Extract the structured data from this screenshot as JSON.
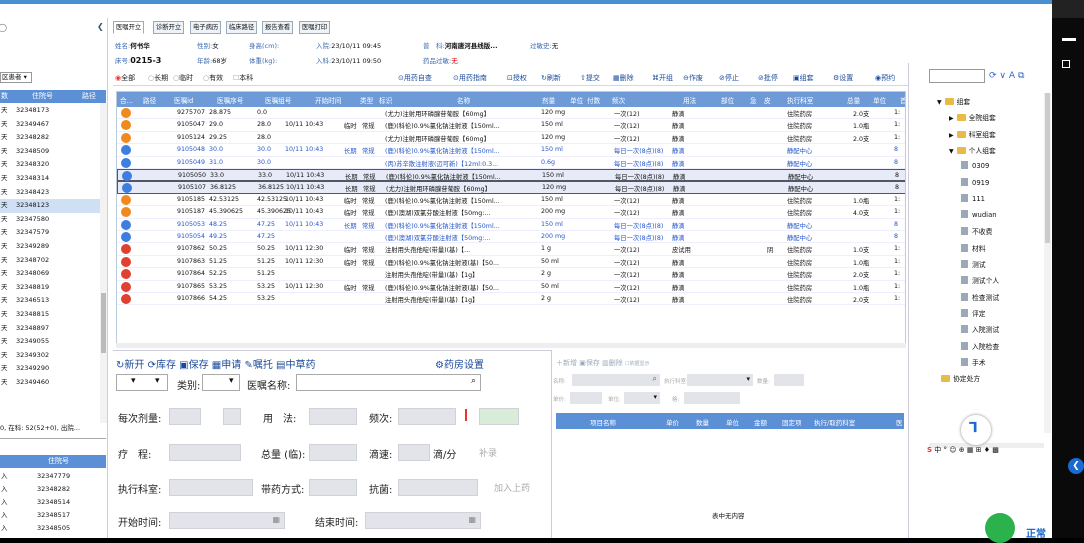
{
  "tabs": [
    "医嘱开立",
    "诊断开立",
    "电子病历",
    "临床路径",
    "报告查看",
    "医嘱打印"
  ],
  "patient": {
    "name_label": "姓名:",
    "name": "何书华",
    "sex_label": "性别:",
    "sex": "女",
    "height_label": "身高(cm):",
    "admit_label": "入院:",
    "admit": "23/10/11 09:45",
    "ward_label": "床号:",
    "ward": "0215-3",
    "age_label": "年龄:",
    "age": "68岁",
    "weight_label": "体重(kg):",
    "enter_label": "入科:",
    "enter": "23/10/11 09:50",
    "dept_label_a": "普",
    "dept_label_b": "科:",
    "dept": "河南唐河县线版...",
    "allergy_label": "过敏史:",
    "allergy": "无",
    "drug_allergy_label": "药品过敏:",
    "drug_allergy": "无"
  },
  "toolbar": {
    "filters": [
      "全部",
      "长期",
      "临时",
      "有效",
      "本科"
    ],
    "actions": [
      "用药自查",
      "用药指南",
      "授权",
      "刷新",
      "提交",
      "删除",
      "开组",
      "作废",
      "停止",
      "批停",
      "组套",
      "设置",
      "预约"
    ]
  },
  "grid": {
    "columns": [
      "合...",
      "路径",
      "医嘱id",
      "医嘱序号",
      "医嘱组号",
      "开始时间",
      "类型",
      "标识",
      "名称",
      "剂量",
      "单位",
      "付数",
      "频次",
      "用法",
      "部位",
      "急",
      "皮",
      "执行科室",
      "总量",
      "单位",
      "首"
    ],
    "rows": [
      {
        "id": "9275707",
        "seq": "28.875",
        "grp": "0.0",
        "start": "",
        "type": "",
        "flag": "",
        "name": "(尤力)注射用环磷腺苷葡胺【60mg】",
        "dose": "120 mg",
        "freq": "一次(12)",
        "usage": "静滴",
        "dept": "住院药房",
        "total": "2.0支",
        "u": "1:",
        "color": "#f08a1e",
        "cls": ""
      },
      {
        "id": "9105047",
        "seq": "29.0",
        "grp": "28.0",
        "start": "10/11 10:43",
        "type": "临时",
        "flag": "常规",
        "name": "(鹿)(科伦)0.9%氯化钠注射液【150ml...",
        "dose": "150 ml",
        "freq": "一次(12)",
        "usage": "静滴",
        "dept": "住院药房",
        "total": "1.0瓶",
        "u": "1:",
        "color": "#f08a1e",
        "cls": ""
      },
      {
        "id": "9105124",
        "seq": "29.25",
        "grp": "28.0",
        "start": "",
        "type": "",
        "flag": "",
        "name": "(尤力)注射用环磷腺苷葡胺【60mg】",
        "dose": "120 mg",
        "freq": "一次(12)",
        "usage": "静滴",
        "dept": "住院药房",
        "total": "2.0支",
        "u": "1:",
        "color": "#f08a1e",
        "cls": ""
      },
      {
        "id": "9105048",
        "seq": "30.0",
        "grp": "30.0",
        "start": "10/11 10:43",
        "type": "长期",
        "flag": "常规",
        "name": "(鹿)(科伦)0.9%氯化钠注射液【150ml...",
        "dose": "150 ml",
        "freq": "每日一次(8点)(8)",
        "usage": "静滴",
        "dept": "静配中心",
        "total": "",
        "u": "8",
        "color": "#3d7fe0",
        "cls": "blue"
      },
      {
        "id": "9105049",
        "seq": "31.0",
        "grp": "30.0",
        "start": "",
        "type": "",
        "flag": "",
        "name": "(丙)苏辛散注射液(迈可新)【12ml:0.3...",
        "dose": "0.6g",
        "freq": "每日一次(8点)(8)",
        "usage": "静滴",
        "dept": "静配中心",
        "total": "",
        "u": "8",
        "color": "#3d7fe0",
        "cls": "blue"
      },
      {
        "id": "9105050",
        "seq": "33.0",
        "grp": "33.0",
        "start": "10/11 10:43",
        "type": "长期",
        "flag": "常规",
        "name": "(鹿)(科伦)0.9%氯化钠注射液【150ml...",
        "dose": "150 ml",
        "freq": "每日一次(8点)(8)",
        "usage": "静滴",
        "dept": "静配中心",
        "total": "",
        "u": "8",
        "color": "#3d7fe0",
        "cls": "sel"
      },
      {
        "id": "9105107",
        "seq": "36.8125",
        "grp": "36.8125",
        "start": "10/11 10:43",
        "type": "长期",
        "flag": "常规",
        "name": "(尤力)注射用环磷腺苷葡胺【60mg】",
        "dose": "120 mg",
        "freq": "每日一次(8点)(8)",
        "usage": "静滴",
        "dept": "静配中心",
        "total": "",
        "u": "8",
        "color": "#3d7fe0",
        "cls": "sel"
      },
      {
        "id": "9105185",
        "seq": "42.53125",
        "grp": "42.53125",
        "start": "10/11 10:43",
        "type": "临时",
        "flag": "常规",
        "name": "(鹿)(科伦)0.9%氯化钠注射液【150ml...",
        "dose": "150 ml",
        "freq": "一次(12)",
        "usage": "静滴",
        "dept": "住院药房",
        "total": "1.0瓶",
        "u": "1:",
        "color": "#f08a1e",
        "cls": ""
      },
      {
        "id": "9105187",
        "seq": "45.390625",
        "grp": "45.390625",
        "start": "10/11 10:43",
        "type": "临时",
        "flag": "常规",
        "name": "(鹿)(澳湖)双氯芬酸注射液【50mg:...",
        "dose": "200 mg",
        "freq": "一次(12)",
        "usage": "静滴",
        "dept": "住院药房",
        "total": "4.0支",
        "u": "1:",
        "color": "#f08a1e",
        "cls": ""
      },
      {
        "id": "9105053",
        "seq": "48.25",
        "grp": "47.25",
        "start": "10/11 10:43",
        "type": "长期",
        "flag": "常规",
        "name": "(鹿)(科伦)0.9%氯化钠注射液【150ml...",
        "dose": "150 ml",
        "freq": "每日一次(8点)(8)",
        "usage": "静滴",
        "dept": "静配中心",
        "total": "",
        "u": "8",
        "color": "#3d7fe0",
        "cls": "blue"
      },
      {
        "id": "9105054",
        "seq": "49.25",
        "grp": "47.25",
        "start": "",
        "type": "",
        "flag": "",
        "name": "(鹿)(澳湖)双氯芬酸注射液【50mg:...",
        "dose": "200 mg",
        "freq": "每日一次(8点)(8)",
        "usage": "静滴",
        "dept": "静配中心",
        "total": "",
        "u": "8",
        "color": "#3d7fe0",
        "cls": "blue"
      },
      {
        "id": "9107862",
        "seq": "50.25",
        "grp": "50.25",
        "start": "10/11 12:30",
        "type": "临时",
        "flag": "常规",
        "name": "注射用头孢他啶(带量)(基)【...",
        "dose": "1 g",
        "freq": "一次(12)",
        "usage": "皮试用",
        "dept": "住院药房",
        "total": "1.0支",
        "u": "1:",
        "color": "#e04030",
        "cls": "",
        "skin": "阴"
      },
      {
        "id": "9107863",
        "seq": "51.25",
        "grp": "51.25",
        "start": "10/11 12:30",
        "type": "临时",
        "flag": "常规",
        "name": "(鹿)(科伦)0.9%氯化钠注射液(基)【50...",
        "dose": "50 ml",
        "freq": "一次(12)",
        "usage": "静滴",
        "dept": "住院药房",
        "total": "1.0瓶",
        "u": "1:",
        "color": "#e04030",
        "cls": ""
      },
      {
        "id": "9107864",
        "seq": "52.25",
        "grp": "51.25",
        "start": "",
        "type": "",
        "flag": "",
        "name": "注射用头孢他啶(带量)(基)【1g】",
        "dose": "2 g",
        "freq": "一次(12)",
        "usage": "静滴",
        "dept": "住院药房",
        "total": "2.0支",
        "u": "1:",
        "color": "#e04030",
        "cls": ""
      },
      {
        "id": "9107865",
        "seq": "53.25",
        "grp": "53.25",
        "start": "10/11 12:30",
        "type": "临时",
        "flag": "常规",
        "name": "(鹿)(科伦)0.9%氯化钠注射液(基)【50...",
        "dose": "50 ml",
        "freq": "一次(12)",
        "usage": "静滴",
        "dept": "住院药房",
        "total": "1.0瓶",
        "u": "1:",
        "color": "#e04030",
        "cls": ""
      },
      {
        "id": "9107866",
        "seq": "54.25",
        "grp": "53.25",
        "start": "",
        "type": "",
        "flag": "",
        "name": "注射用头孢他啶(带量)(基)【1g】",
        "dose": "2 g",
        "freq": "一次(12)",
        "usage": "静滴",
        "dept": "住院药房",
        "total": "2.0支",
        "u": "1:",
        "color": "#e04030",
        "cls": ""
      }
    ]
  },
  "left": {
    "filter": "区患者",
    "header": [
      "数",
      "住院号",
      "路径"
    ],
    "rows": [
      {
        "a": "天",
        "b": "32348173"
      },
      {
        "a": "天",
        "b": "32349467"
      },
      {
        "a": "天",
        "b": "32348282"
      },
      {
        "a": "天",
        "b": "32348509"
      },
      {
        "a": "天",
        "b": "32348320"
      },
      {
        "a": "天",
        "b": "32348314"
      },
      {
        "a": "天",
        "b": "32348423"
      },
      {
        "a": "天",
        "b": "32348123"
      },
      {
        "a": "天",
        "b": "32347580"
      },
      {
        "a": "天",
        "b": "32347579"
      },
      {
        "a": "天",
        "b": "32349289"
      },
      {
        "a": "天",
        "b": "32348702"
      },
      {
        "a": "天",
        "b": "32348069"
      },
      {
        "a": "天",
        "b": "32348819"
      },
      {
        "a": "天",
        "b": "32346513"
      },
      {
        "a": "天",
        "b": "32348815"
      },
      {
        "a": "天",
        "b": "32348897"
      },
      {
        "a": "天",
        "b": "32349055"
      },
      {
        "a": "天",
        "b": "32349302"
      },
      {
        "a": "天",
        "b": "32349290"
      },
      {
        "a": "天",
        "b": "32349460"
      }
    ],
    "status": "0, 在科: 52(52+0), 出院...",
    "header2": "住院号",
    "rows2": [
      {
        "a": "入",
        "b": "32347779"
      },
      {
        "a": "入",
        "b": "32348282"
      },
      {
        "a": "入",
        "b": "32348514"
      },
      {
        "a": "入",
        "b": "32348517"
      },
      {
        "a": "入",
        "b": "32348505"
      }
    ]
  },
  "form": {
    "actions": [
      "新开",
      "库存",
      "保存",
      "申请",
      "嘱托",
      "中草药",
      "药房设置"
    ],
    "category_label": "类别:",
    "order_name_label": "医嘱名称:",
    "dose_label": "每次剂量:",
    "usage_label": "用　法:",
    "freq_label": "频次:",
    "course_label": "疗　程:",
    "total_label": "总量 (临):",
    "drip_label": "滴速:",
    "drip_unit": "滴/分",
    "record": "补录",
    "exec_label": "执行科室:",
    "carry_label": "带药方式:",
    "anti_label": "抗菌:",
    "add_label": "加入上药",
    "start_label": "开始时间:",
    "end_label": "结束时间:"
  },
  "mid": {
    "actions": [
      "新增",
      "保存",
      "删除",
      "依据显示"
    ],
    "name_label": "名称:",
    "exec_label": "执行科室:",
    "qty_label": "数量:",
    "unit_label": "单价:",
    "unit2_label": "单位:",
    "item_label": "格:",
    "columns": [
      "项目名称",
      "单价",
      "数量",
      "单位",
      "金额",
      "固定项",
      "执行/取药科室",
      "医"
    ],
    "empty": "表中无内容"
  },
  "tree": {
    "items": [
      {
        "label": "组套",
        "level": 0,
        "type": "folder"
      },
      {
        "label": "全院组套",
        "level": 1,
        "type": "folder"
      },
      {
        "label": "科室组套",
        "level": 1,
        "type": "folder"
      },
      {
        "label": "个人组套",
        "level": 1,
        "type": "folder"
      },
      {
        "label": "0309",
        "level": 2,
        "type": "doc"
      },
      {
        "label": "0919",
        "level": 2,
        "type": "doc"
      },
      {
        "label": "111",
        "level": 2,
        "type": "doc"
      },
      {
        "label": "wudian",
        "level": 2,
        "type": "doc"
      },
      {
        "label": "不收费",
        "level": 2,
        "type": "doc"
      },
      {
        "label": "材料",
        "level": 2,
        "type": "doc"
      },
      {
        "label": "测试",
        "level": 2,
        "type": "doc"
      },
      {
        "label": "测试个人",
        "level": 2,
        "type": "doc"
      },
      {
        "label": "检查测试",
        "level": 2,
        "type": "doc"
      },
      {
        "label": "评定",
        "level": 2,
        "type": "doc"
      },
      {
        "label": "入院测试",
        "level": 2,
        "type": "doc"
      },
      {
        "label": "入院检查",
        "level": 2,
        "type": "doc"
      },
      {
        "label": "手术",
        "level": 2,
        "type": "doc"
      },
      {
        "label": "协定处方",
        "level": 1,
        "type": "folder"
      }
    ],
    "status": "正常"
  }
}
